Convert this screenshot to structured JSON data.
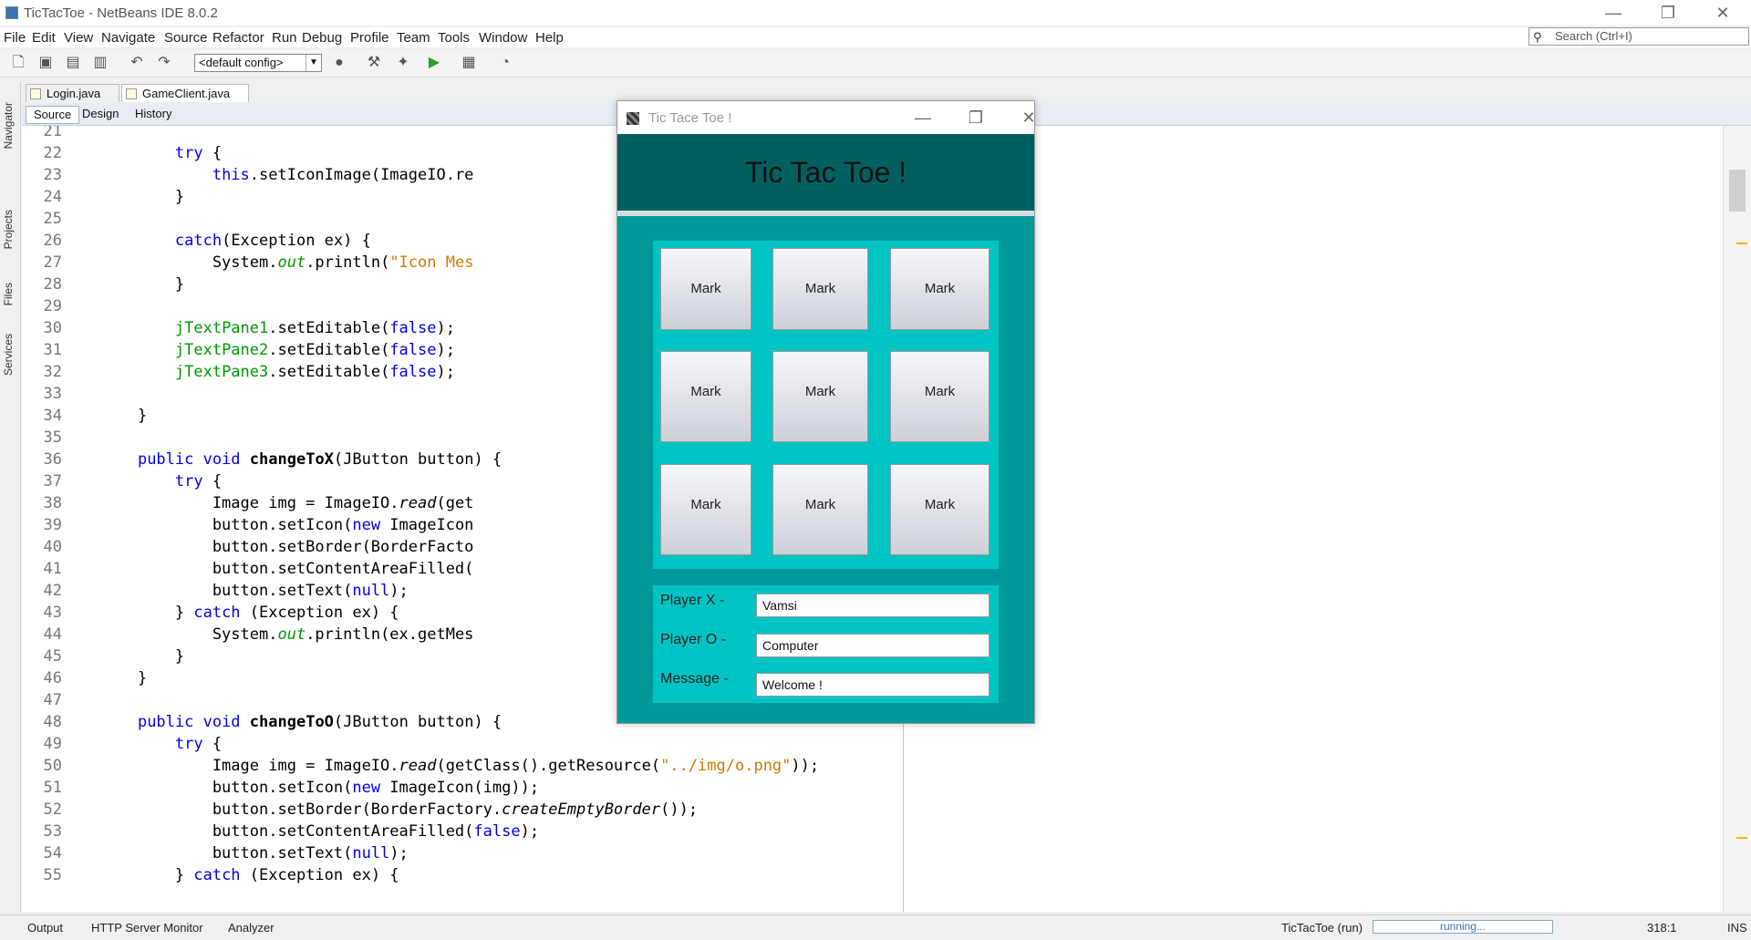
{
  "window": {
    "title": "TicTacToe - NetBeans IDE 8.0.2",
    "minimize": "—",
    "maximize": "❐",
    "close": "✕"
  },
  "menu": [
    "File",
    "Edit",
    "View",
    "Navigate",
    "Source",
    "Refactor",
    "Run",
    "Debug",
    "Profile",
    "Team",
    "Tools",
    "Window",
    "Help"
  ],
  "search": {
    "placeholder": "Search (Ctrl+I)"
  },
  "toolbar": {
    "config": "<default config>"
  },
  "side_panels": [
    "Navigator",
    "Projects",
    "Files",
    "Services"
  ],
  "tabs": [
    {
      "label": "Login.java",
      "close": "✕"
    },
    {
      "label": "GameClient.java",
      "close": "✕"
    }
  ],
  "editor_tabs": [
    "Source",
    "Design",
    "History"
  ],
  "status": {
    "output": "Output",
    "http_monitor": "HTTP Server Monitor",
    "analyzer": "Analyzer",
    "run_label": "TicTacToe (run)",
    "progress": "running...",
    "position": "318:1",
    "mode": "INS"
  },
  "code_lines": [
    {
      "n": "21",
      "html": ""
    },
    {
      "n": "22",
      "html": "        <span class=\"kw\">try</span> {"
    },
    {
      "n": "23",
      "html": "            <span class=\"kw\">this</span>.setIconImage(ImageIO.re                                    <span class=\"str\">f\"</span>)));"
    },
    {
      "n": "24",
      "html": "        }"
    },
    {
      "n": "25",
      "html": ""
    },
    {
      "n": "26",
      "html": "        <span class=\"kw\">catch</span>(Exception ex) {"
    },
    {
      "n": "27",
      "html": "            System.<span class=\"fld it\">out</span>.println(<span class=\"str\">\"Icon Mes</span>"
    },
    {
      "n": "28",
      "html": "        }"
    },
    {
      "n": "29",
      "html": ""
    },
    {
      "n": "30",
      "html": "        <span class=\"fld\">jTextPane1</span>.setEditable(<span class=\"kw\">false</span>);"
    },
    {
      "n": "31",
      "html": "        <span class=\"fld\">jTextPane2</span>.setEditable(<span class=\"kw\">false</span>);"
    },
    {
      "n": "32",
      "html": "        <span class=\"fld\">jTextPane3</span>.setEditable(<span class=\"kw\">false</span>);"
    },
    {
      "n": "33",
      "html": ""
    },
    {
      "n": "34",
      "html": "    }"
    },
    {
      "n": "35",
      "html": ""
    },
    {
      "n": "36",
      "html": "    <span class=\"kw\">public void</span> <span class=\"bold\">changeToX</span>(JButton button) {"
    },
    {
      "n": "37",
      "html": "        <span class=\"kw\">try</span> {"
    },
    {
      "n": "38",
      "html": "            Image img = ImageIO.<span class=\"it\">read</span>(get"
    },
    {
      "n": "39",
      "html": "            button.setIcon(<span class=\"kw\">new</span> ImageIcon"
    },
    {
      "n": "40",
      "html": "            button.setBorder(BorderFacto"
    },
    {
      "n": "41",
      "html": "            button.setContentAreaFilled("
    },
    {
      "n": "42",
      "html": "            button.setText(<span class=\"kw\">null</span>);"
    },
    {
      "n": "43",
      "html": "        } <span class=\"kw\">catch</span> (Exception ex) {"
    },
    {
      "n": "44",
      "html": "            System.<span class=\"fld it\">out</span>.println(ex.getMes"
    },
    {
      "n": "45",
      "html": "        }"
    },
    {
      "n": "46",
      "html": "    }"
    },
    {
      "n": "47",
      "html": ""
    },
    {
      "n": "48",
      "html": "    <span class=\"kw\">public void</span> <span class=\"bold\">changeToO</span>(JButton button) {"
    },
    {
      "n": "49",
      "html": "        <span class=\"kw\">try</span> {"
    },
    {
      "n": "50",
      "html": "            Image img = ImageIO.<span class=\"it\">read</span>(getClass().getResource(<span class=\"str\">\"../img/o.png\"</span>));"
    },
    {
      "n": "51",
      "html": "            button.setIcon(<span class=\"kw\">new</span> ImageIcon(img));"
    },
    {
      "n": "52",
      "html": "            button.setBorder(BorderFactory.<span class=\"it\">createEmptyBorder</span>());"
    },
    {
      "n": "53",
      "html": "            button.setContentAreaFilled(<span class=\"kw\">false</span>);"
    },
    {
      "n": "54",
      "html": "            button.setText(<span class=\"kw\">null</span>);"
    },
    {
      "n": "55",
      "html": "        } <span class=\"kw\">catch</span> (Exception ex) {"
    }
  ],
  "game": {
    "window_title": "Tic Tace Toe !",
    "header": "Tic Tac Toe !",
    "cell_label": "Mark",
    "player_x_label": "Player X -",
    "player_x_value": "Vamsi",
    "player_o_label": "Player O -",
    "player_o_value": "Computer",
    "message_label": "Message -",
    "message_value": "Welcome !"
  },
  "colors": {
    "game_bg": "#009999",
    "game_header": "#006060",
    "board_bg": "#00c4c4",
    "keyword": "#0000e6",
    "field": "#009900",
    "string": "#ce7b00"
  }
}
